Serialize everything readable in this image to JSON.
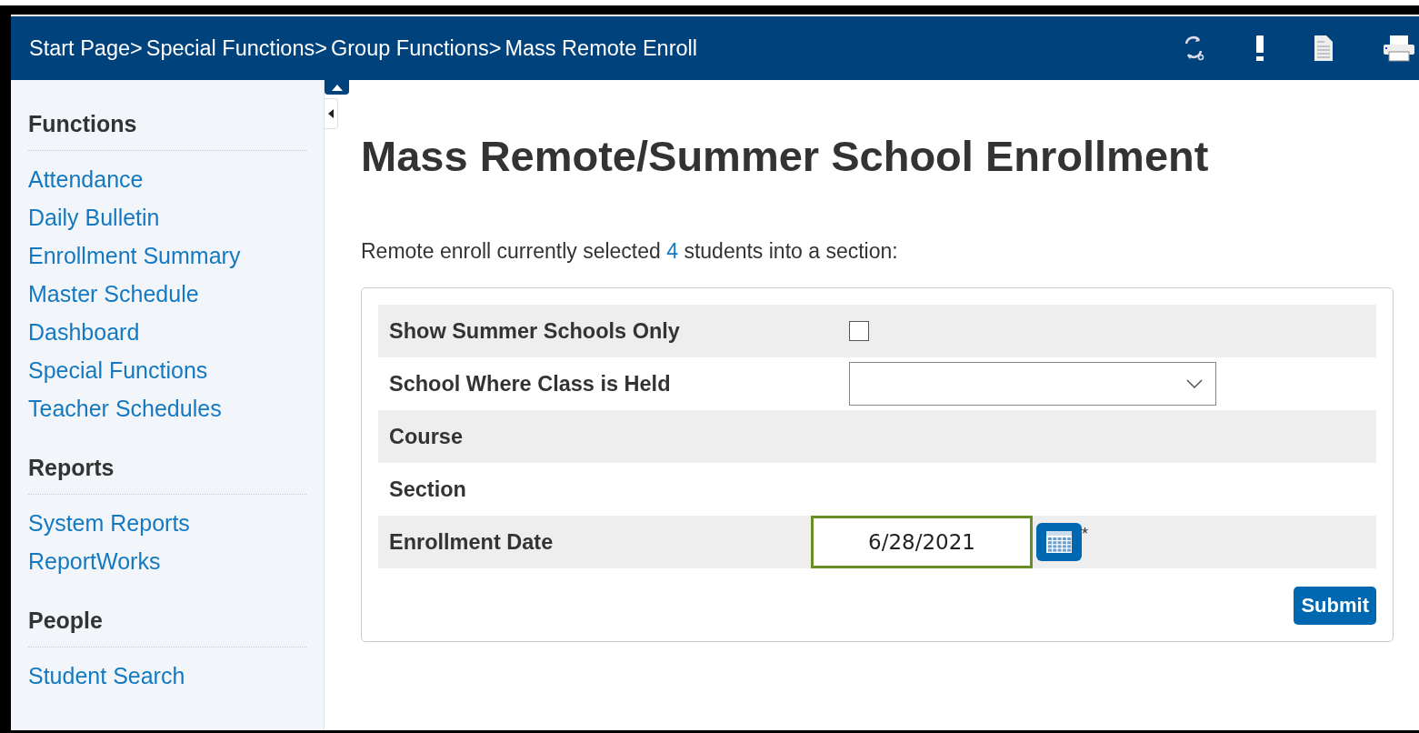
{
  "breadcrumb": [
    "Start Page>",
    "Special Functions>",
    "Group Functions>",
    "Mass Remote Enroll"
  ],
  "toolbar": [
    {
      "kind": "refresh"
    },
    {
      "kind": "alert"
    },
    {
      "kind": "document"
    },
    {
      "kind": "print"
    }
  ],
  "sidebar": {
    "sections": [
      {
        "title": "Functions",
        "items": [
          "Attendance",
          "Daily Bulletin",
          "Enrollment Summary",
          "Master Schedule",
          "Dashboard",
          "Special Functions",
          "Teacher Schedules"
        ]
      },
      {
        "title": "Reports",
        "items": [
          "System Reports",
          "ReportWorks"
        ]
      },
      {
        "title": "People",
        "items": [
          "Student Search"
        ]
      }
    ]
  },
  "page_title": "Mass Remote/Summer School Enrollment",
  "intro": {
    "before": "Remote enroll currently selected ",
    "count": "4",
    "after": " students into a section:"
  },
  "form": {
    "rows": [
      {
        "label": "Show Summer Schools Only",
        "kind": "checkbox",
        "checked": false
      },
      {
        "label": "School Where Class is Held",
        "kind": "select"
      },
      {
        "label": "Course",
        "kind": "none"
      },
      {
        "label": "Section",
        "kind": "none"
      },
      {
        "label": "Enrollment Date",
        "kind": "date",
        "value": "6/28/2021",
        "required_mark": "*"
      }
    ],
    "submit": "Submit"
  }
}
